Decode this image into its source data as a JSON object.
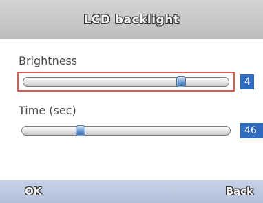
{
  "window": {
    "title": "LCD backlight"
  },
  "settings": [
    {
      "label": "Brightness",
      "value": "4",
      "level_fraction": 0.77,
      "focused": true
    },
    {
      "label": "Time (sec)",
      "value": "46",
      "level_fraction": 0.28,
      "focused": false
    }
  ],
  "softkeys": {
    "left_label": "OK",
    "right_label": "Back"
  },
  "colors": {
    "focus_border": "#e05a50",
    "value_box": "#2f6cc0",
    "title_bar": "#c8c8c6",
    "softkey_bar": "#bcc8e0"
  }
}
